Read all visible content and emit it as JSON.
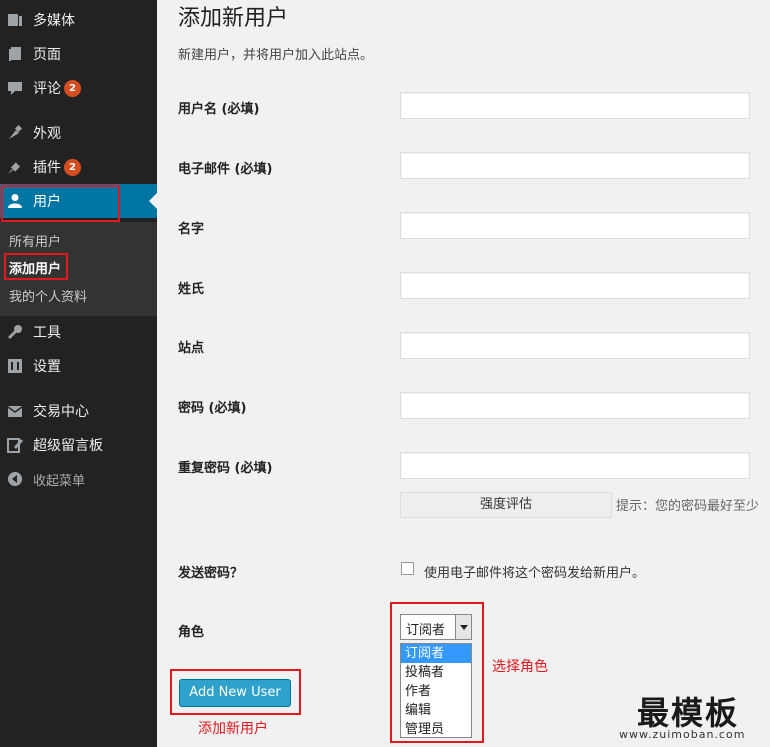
{
  "sidebar": {
    "items": [
      {
        "label": "多媒体",
        "icon": "media-icon"
      },
      {
        "label": "页面",
        "icon": "pages-icon"
      },
      {
        "label": "评论",
        "icon": "comments-icon",
        "badge": "2"
      },
      {
        "label": "外观",
        "icon": "appearance-icon"
      },
      {
        "label": "插件",
        "icon": "plugins-icon",
        "badge": "2"
      },
      {
        "label": "用户",
        "icon": "users-icon",
        "active": true
      },
      {
        "label": "工具",
        "icon": "tools-icon"
      },
      {
        "label": "设置",
        "icon": "settings-icon"
      },
      {
        "label": "交易中心",
        "icon": "store-icon"
      },
      {
        "label": "超级留言板",
        "icon": "guestbook-icon"
      },
      {
        "label": "收起菜单",
        "icon": "collapse-icon"
      }
    ],
    "submenu": [
      "所有用户",
      "添加用户",
      "我的个人资料"
    ]
  },
  "page": {
    "title": "添加新用户",
    "description": "新建用户，并将用户加入此站点。"
  },
  "form": {
    "labels": {
      "username": "用户名 (必填)",
      "email": "电子邮件 (必填)",
      "first_name": "名字",
      "last_name": "姓氏",
      "website": "站点",
      "password": "密码 (必填)",
      "password_repeat": "重复密码 (必填)",
      "send_password": "发送密码？",
      "role": "角色"
    },
    "strength_label": "强度评估",
    "hint": "提示：您的密码最好至少",
    "send_checkbox_label": "使用电子邮件将这个密码发给新用户。",
    "role_selected": "订阅者",
    "role_options": [
      "订阅者",
      "投稿者",
      "作者",
      "编辑",
      "管理员"
    ],
    "submit_label": "Add New User"
  },
  "annotations": {
    "role": "选择角色",
    "add_user": "添加新用户"
  },
  "watermark": {
    "main": "最模板",
    "sub": "www.zuimoban.com"
  },
  "colors": {
    "sidebar_bg": "#222222",
    "active_bg": "#0074a2",
    "badge": "#d54e21",
    "button": "#2ea2cc",
    "annotation_red": "#e1191e",
    "selected_option": "#3399ff"
  }
}
